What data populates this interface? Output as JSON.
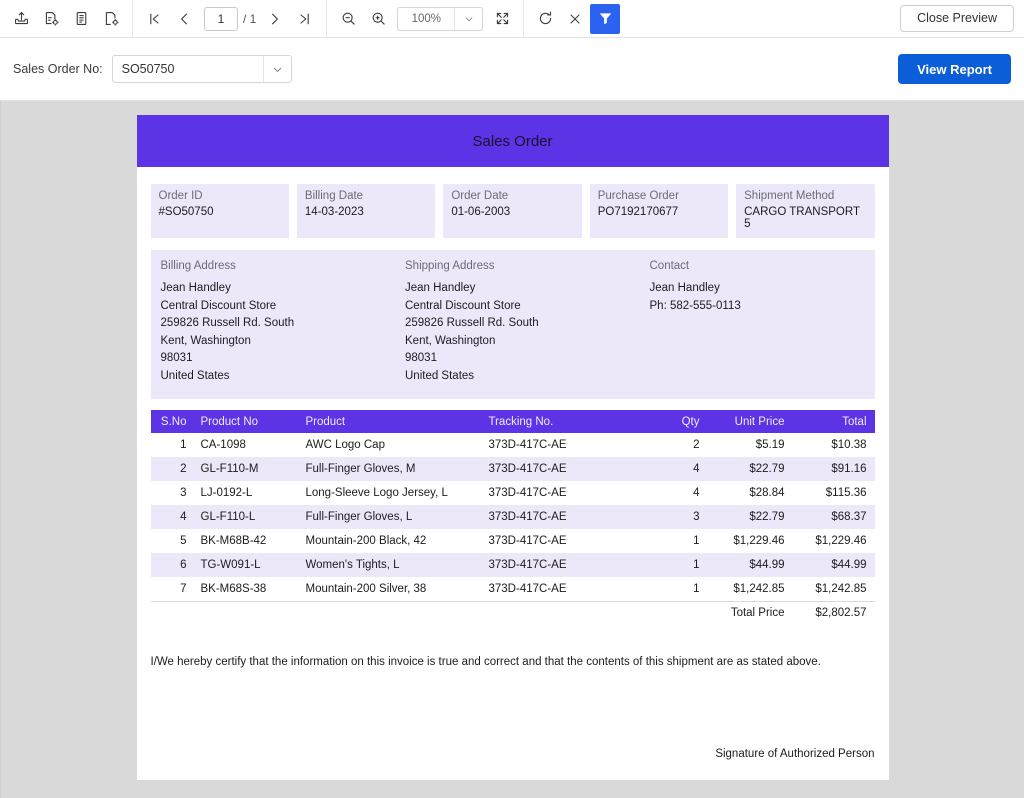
{
  "toolbar": {
    "buttons": [
      {
        "name": "export-icon",
        "title": "Export"
      },
      {
        "name": "print-icon",
        "title": "Print"
      },
      {
        "name": "document-icon",
        "title": "Document Map"
      },
      {
        "name": "page-setup-icon",
        "title": "Page Setup"
      }
    ],
    "nav": {
      "first_title": "First Page",
      "prev_title": "Previous Page",
      "page_value": "1",
      "page_total": "/ 1",
      "next_title": "Next Page",
      "last_title": "Last Page"
    },
    "zoom": {
      "out_title": "Zoom Out",
      "in_title": "Zoom In",
      "value": "100%",
      "fullscreen_title": "Full Screen"
    },
    "actions": {
      "refresh_title": "Refresh",
      "stop_title": "Stop",
      "filter_title": "Parameters"
    },
    "close_preview_label": "Close Preview"
  },
  "parameters": {
    "label": "Sales Order No:",
    "selected_value": "SO50750",
    "view_report_label": "View Report"
  },
  "report": {
    "title": "Sales Order",
    "info_cards": [
      {
        "label": "Order ID",
        "value": "#SO50750"
      },
      {
        "label": "Billing Date",
        "value": "14-03-2023"
      },
      {
        "label": "Order Date",
        "value": "01-06-2003"
      },
      {
        "label": "Purchase Order",
        "value": "PO7192170677"
      },
      {
        "label": "Shipment Method",
        "value": "CARGO TRANSPORT 5"
      }
    ],
    "billing": {
      "title": "Billing Address",
      "lines": [
        "Jean Handley",
        "Central Discount Store",
        "259826 Russell Rd. South",
        "Kent, Washington",
        "98031",
        "United States"
      ]
    },
    "shipping": {
      "title": "Shipping Address",
      "lines": [
        "Jean Handley",
        "Central Discount Store",
        "259826 Russell Rd. South",
        "Kent, Washington",
        "98031",
        "United States"
      ]
    },
    "contact": {
      "title": "Contact",
      "lines": [
        "Jean Handley",
        "Ph: 582-555-0113"
      ]
    },
    "table": {
      "headers": [
        "S.No",
        "Product No",
        "Product",
        "Tracking No.",
        "Qty",
        "Unit Price",
        "Total"
      ],
      "rows": [
        {
          "sno": "1",
          "product_no": "CA-1098",
          "product": "AWC Logo Cap",
          "tracking": "373D-417C-AE",
          "qty": "2",
          "unit_price": "$5.19",
          "total": "$10.38"
        },
        {
          "sno": "2",
          "product_no": "GL-F110-M",
          "product": "Full-Finger Gloves, M",
          "tracking": "373D-417C-AE",
          "qty": "4",
          "unit_price": "$22.79",
          "total": "$91.16"
        },
        {
          "sno": "3",
          "product_no": "LJ-0192-L",
          "product": "Long-Sleeve Logo Jersey, L",
          "tracking": "373D-417C-AE",
          "qty": "4",
          "unit_price": "$28.84",
          "total": "$115.36"
        },
        {
          "sno": "4",
          "product_no": "GL-F110-L",
          "product": "Full-Finger Gloves, L",
          "tracking": "373D-417C-AE",
          "qty": "3",
          "unit_price": "$22.79",
          "total": "$68.37"
        },
        {
          "sno": "5",
          "product_no": "BK-M68B-42",
          "product": "Mountain-200 Black, 42",
          "tracking": "373D-417C-AE",
          "qty": "1",
          "unit_price": "$1,229.46",
          "total": "$1,229.46"
        },
        {
          "sno": "6",
          "product_no": "TG-W091-L",
          "product": "Women's Tights, L",
          "tracking": "373D-417C-AE",
          "qty": "1",
          "unit_price": "$44.99",
          "total": "$44.99"
        },
        {
          "sno": "7",
          "product_no": "BK-M68S-38",
          "product": "Mountain-200 Silver, 38",
          "tracking": "373D-417C-AE",
          "qty": "1",
          "unit_price": "$1,242.85",
          "total": "$1,242.85"
        }
      ],
      "total_label": "Total Price",
      "total_value": "$2,802.57"
    },
    "certification": "I/We hereby certify that the information on this invoice is true and correct and that the contents of this shipment are as stated above.",
    "signature_label": "Signature of Authorized Person"
  },
  "colors": {
    "brand_purple": "#5c34e6",
    "soft_purple": "#ece8fa",
    "primary_blue": "#0b5ed7",
    "toolbar_active_blue": "#2b62f0"
  }
}
